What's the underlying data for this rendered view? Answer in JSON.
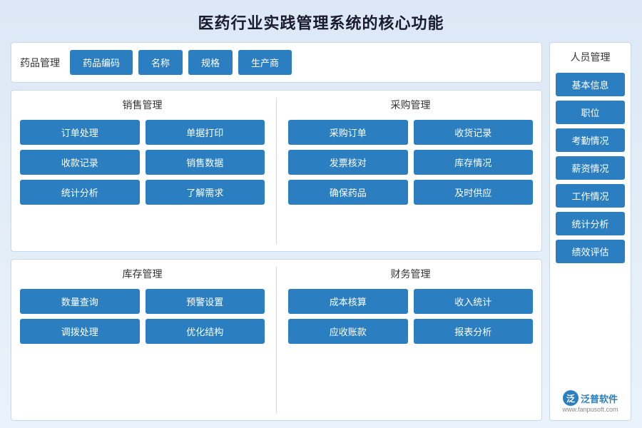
{
  "page": {
    "title": "医药行业实践管理系统的核心功能"
  },
  "drug_panel": {
    "label": "药品管理",
    "buttons": [
      "药品编码",
      "名称",
      "规格",
      "生产商"
    ]
  },
  "sales_panel": {
    "title": "销售管理",
    "buttons_row1": [
      "订单处理",
      "单据打印"
    ],
    "buttons_row2": [
      "收款记录",
      "销售数据"
    ],
    "buttons_row3": [
      "统计分析",
      "了解需求"
    ]
  },
  "purchase_panel": {
    "title": "采购管理",
    "buttons_row1": [
      "采购订单",
      "收货记录"
    ],
    "buttons_row2": [
      "发票核对",
      "库存情况"
    ],
    "buttons_row3": [
      "确保药品",
      "及时供应"
    ]
  },
  "inventory_panel": {
    "title": "库存管理",
    "buttons_row1": [
      "数量查询",
      "预警设置"
    ],
    "buttons_row2": [
      "调拨处理",
      "优化结构"
    ]
  },
  "finance_panel": {
    "title": "财务管理",
    "buttons_row1": [
      "成本核算",
      "收入统计"
    ],
    "buttons_row2": [
      "应收账款",
      "报表分析"
    ]
  },
  "sidebar": {
    "title": "人员管理",
    "buttons": [
      "基本信息",
      "职位",
      "考勤情况",
      "薪资情况",
      "工作情况",
      "统计分析",
      "绩效评估"
    ]
  },
  "logo": {
    "icon": "泛",
    "name": "泛普软件",
    "url": "www.fanpusoft.com"
  }
}
